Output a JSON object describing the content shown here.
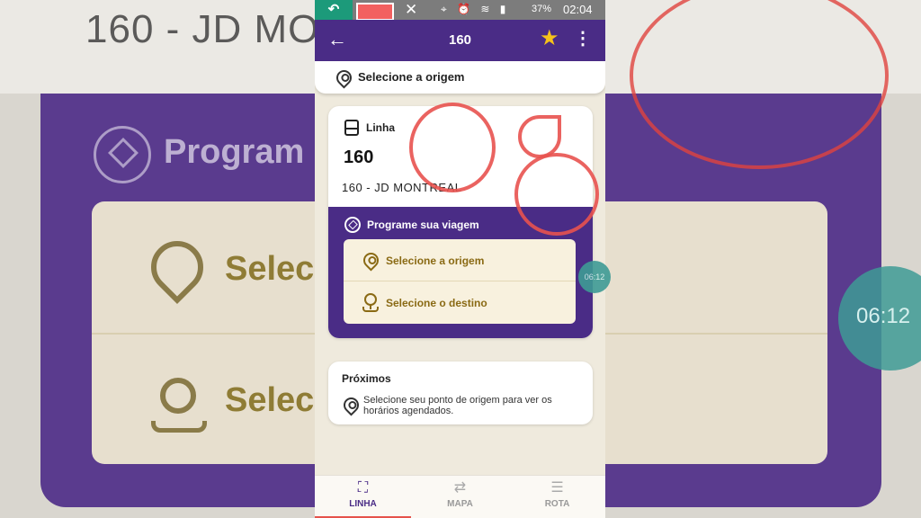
{
  "background": {
    "title": "160 - JD MO",
    "program_text": "Program",
    "select1": "Selec",
    "select2": "Selec",
    "bubble_time": "06:12"
  },
  "status_bar": {
    "battery": "37%",
    "time": "02:04"
  },
  "app_bar": {
    "title": "160"
  },
  "origin_bar": {
    "label": "Selecione a origem"
  },
  "line_card": {
    "label": "Linha",
    "number": "160",
    "name": "160 - JD MONTREAL"
  },
  "plan": {
    "title": "Programe sua viagem",
    "origin_label": "Selecione a origem",
    "destination_label": "Selecione o destino"
  },
  "proximos": {
    "title": "Próximos",
    "text": "Selecione seu ponto de origem para ver os horários agendados."
  },
  "bottom_nav": {
    "items": [
      {
        "label": "LINHA",
        "icon": "map-icon"
      },
      {
        "label": "MAPA",
        "icon": "route-icon"
      },
      {
        "label": "ROTA",
        "icon": "list-icon"
      }
    ]
  },
  "overlay": {
    "bubble_time": "06:12"
  },
  "colors": {
    "primary": "#4a2c86",
    "accent_star": "#f6c21a",
    "gold_text": "#8a6a14",
    "annotation": "#e8524f"
  }
}
